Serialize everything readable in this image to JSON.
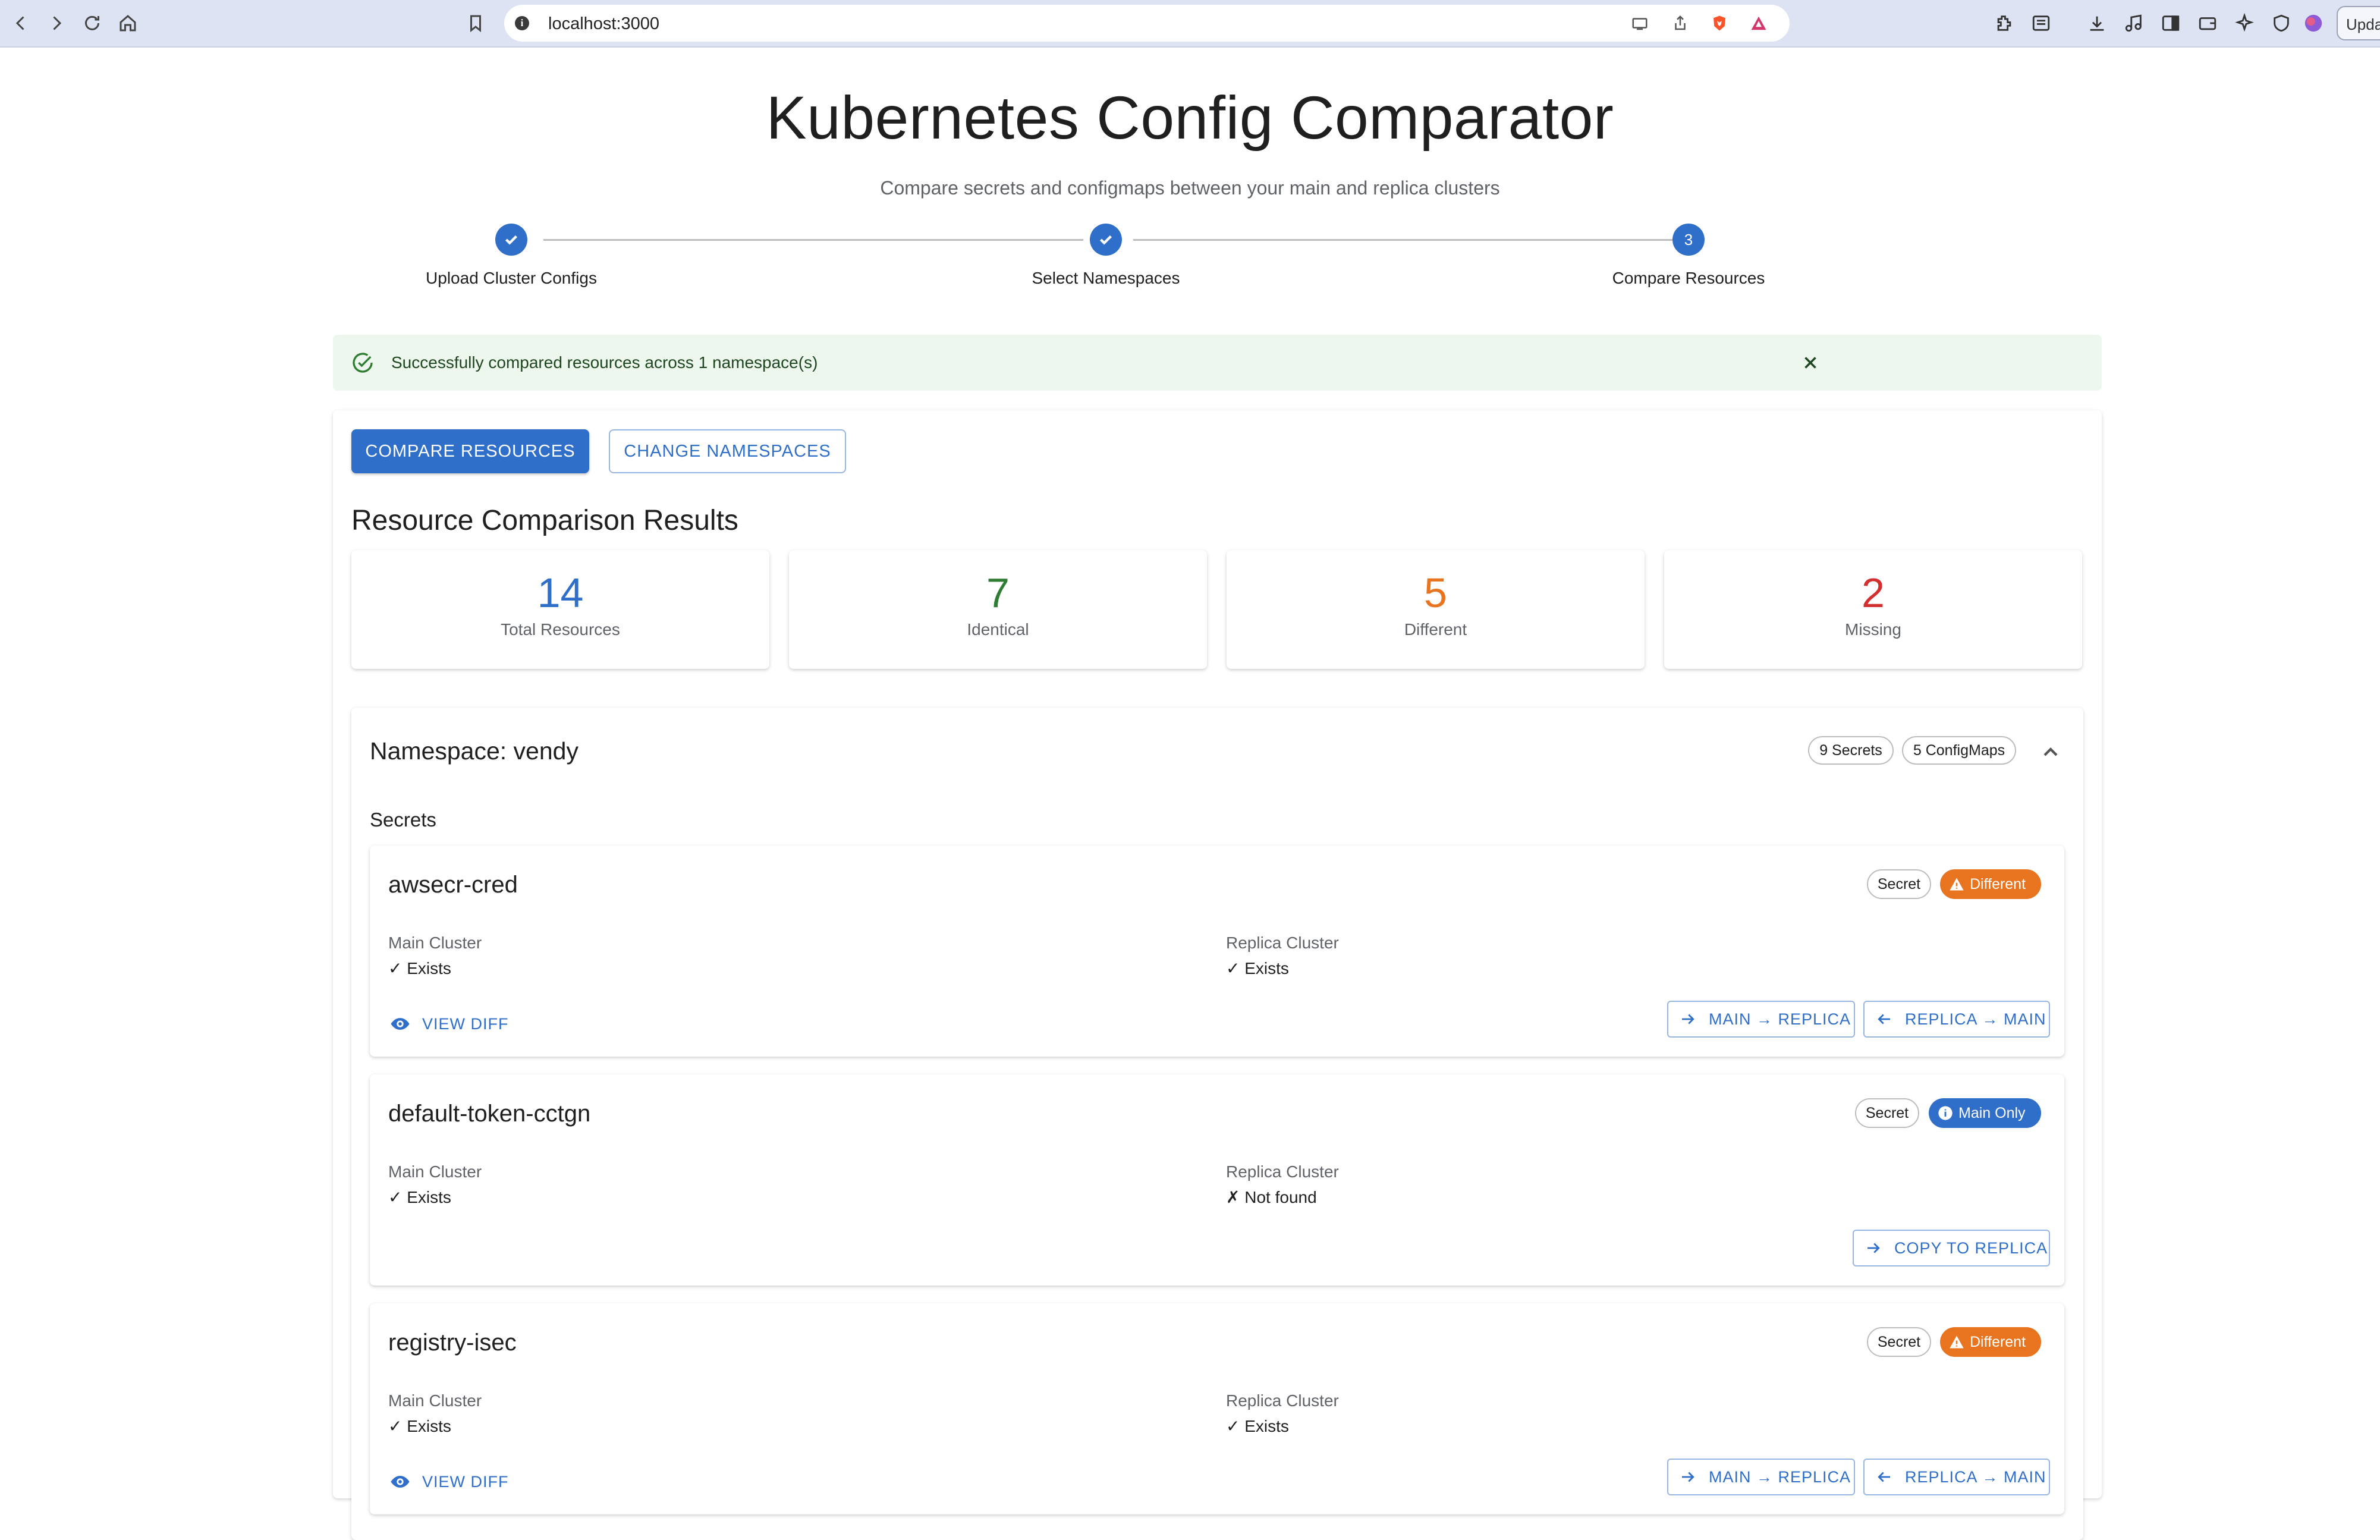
{
  "browser": {
    "url": "localhost:3000",
    "update_label": "Update"
  },
  "header": {
    "title": "Kubernetes Config Comparator",
    "subtitle": "Compare secrets and configmaps between your main and replica clusters"
  },
  "stepper": {
    "steps": [
      {
        "label": "Upload Cluster Configs",
        "state": "completed"
      },
      {
        "label": "Select Namespaces",
        "state": "completed"
      },
      {
        "label": "Compare Resources",
        "state": "active",
        "number": "3"
      }
    ]
  },
  "alert": {
    "message": "Successfully compared resources across 1 namespace(s)"
  },
  "actions": {
    "compare_label": "COMPARE RESOURCES",
    "change_label": "CHANGE NAMESPACES"
  },
  "results": {
    "title": "Resource Comparison Results",
    "stats": [
      {
        "value": "14",
        "label": "Total Resources",
        "color": "#2f6fc9"
      },
      {
        "value": "7",
        "label": "Identical",
        "color": "#2e7d32"
      },
      {
        "value": "5",
        "label": "Different",
        "color": "#e8741f"
      },
      {
        "value": "2",
        "label": "Missing",
        "color": "#d32f2f"
      }
    ]
  },
  "namespace": {
    "title": "Namespace: vendy",
    "secrets_chip": "9 Secrets",
    "configmaps_chip": "5 ConfigMaps",
    "section_label": "Secrets",
    "resources": [
      {
        "name": "awsecr-cred",
        "type": "Secret",
        "status": "Different",
        "main_label": "Main Cluster",
        "main_value": "✓ Exists",
        "replica_label": "Replica Cluster",
        "replica_value": "✓ Exists",
        "view_diff": "VIEW DIFF",
        "to_replica": "MAIN → REPLICA",
        "to_main": "REPLICA → MAIN"
      },
      {
        "name": "default-token-cctgn",
        "type": "Secret",
        "status": "Main Only",
        "main_label": "Main Cluster",
        "main_value": "✓ Exists",
        "replica_label": "Replica Cluster",
        "replica_value": "✗ Not found",
        "copy_label": "COPY TO REPLICA"
      },
      {
        "name": "registry-isec",
        "type": "Secret",
        "status": "Different",
        "main_label": "Main Cluster",
        "main_value": "✓ Exists",
        "replica_label": "Replica Cluster",
        "replica_value": "✓ Exists",
        "view_diff": "VIEW DIFF",
        "to_replica": "MAIN → REPLICA",
        "to_main": "REPLICA → MAIN"
      }
    ]
  }
}
